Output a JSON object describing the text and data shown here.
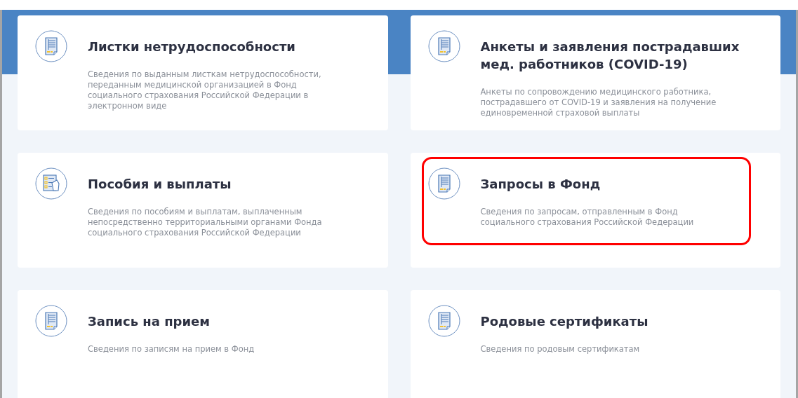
{
  "services": [
    {
      "title": "Листки нетрудоспособности",
      "description": "Сведения по выданным листкам нетрудоспособности, переданным медицинской организацией в Фонд социального страхования Российской Федерации в электронном виде",
      "kind": "document",
      "highlighted": false
    },
    {
      "title": "Анкеты и заявления пострадавших мед. работников (COVID-19)",
      "description": "Анкеты по сопровождению медицинского работника, пострадавшего от COVID-19 и заявления на получение единовременной страховой выплаты",
      "kind": "document",
      "highlighted": false
    },
    {
      "title": "Пособия и выплаты",
      "description": "Сведения по пособиям и выплатам, выплаченным непосредственно территориальными органами Фонда социального страхования Российской Федерации",
      "kind": "checklist",
      "highlighted": false
    },
    {
      "title": "Запросы в Фонд",
      "description": "Сведения по запросам, отправленным в Фонд социального страхования Российской Федерации",
      "kind": "document",
      "highlighted": true
    },
    {
      "title": "Запись на прием",
      "description": "Сведения по записям на прием в Фонд",
      "kind": "document",
      "highlighted": false
    },
    {
      "title": "Родовые сертификаты",
      "description": "Сведения по родовым сертификатам",
      "kind": "document",
      "highlighted": false
    }
  ]
}
